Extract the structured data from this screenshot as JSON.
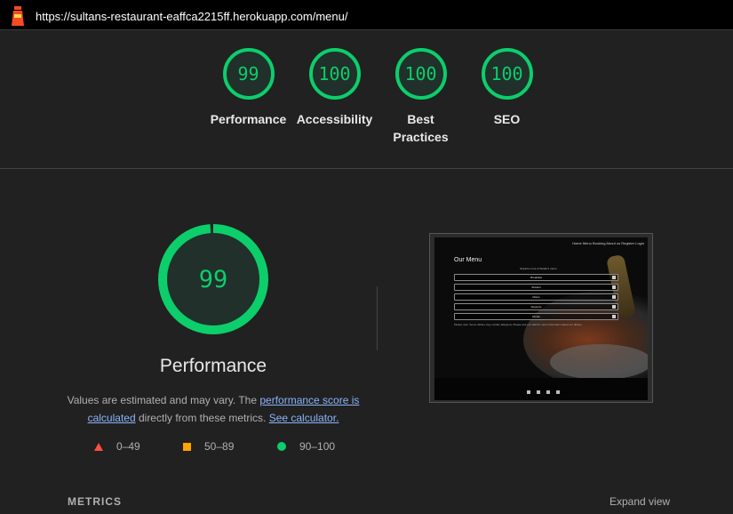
{
  "topbar": {
    "url": "https://sultans-restaurant-eaffca2215ff.herokuapp.com/menu/",
    "logo_icon": "lighthouse-icon"
  },
  "scores": [
    {
      "value": "99",
      "label_lines": [
        "Performance"
      ]
    },
    {
      "value": "100",
      "label_lines": [
        "Accessibility"
      ]
    },
    {
      "value": "100",
      "label_lines": [
        "Best",
        "Practices"
      ]
    },
    {
      "value": "100",
      "label_lines": [
        "SEO"
      ]
    }
  ],
  "main": {
    "score": "99",
    "score_fraction": 0.99,
    "title": "Performance",
    "desc_before": "Values are estimated and may vary. The ",
    "desc_link1": "performance score is calculated",
    "desc_middle": " directly from these metrics. ",
    "desc_link2": "See calculator."
  },
  "legend": [
    {
      "icon": "fail-triangle-icon",
      "range": "0–49"
    },
    {
      "icon": "average-square-icon",
      "range": "50–89"
    },
    {
      "icon": "pass-circle-icon",
      "range": "90–100"
    }
  ],
  "screenshot": {
    "nav": "Home  Menu  Booking  About us  Register  Login",
    "title": "Our Menu",
    "subtitle": "Explore more of Sultan's menu",
    "rows": [
      "Breakfast",
      "Starters",
      "Mains",
      "Desserts",
      "Drinks"
    ],
    "note": "Please note: Some dishes may contain allergens. Please ask our staff for more information about our dishes."
  },
  "footer": {
    "metrics_label": "METRICS",
    "expand_label": "Expand view"
  },
  "colors": {
    "pass": "#0cce6b",
    "average": "#ffa400",
    "fail": "#ff4e42",
    "background": "#212121"
  }
}
